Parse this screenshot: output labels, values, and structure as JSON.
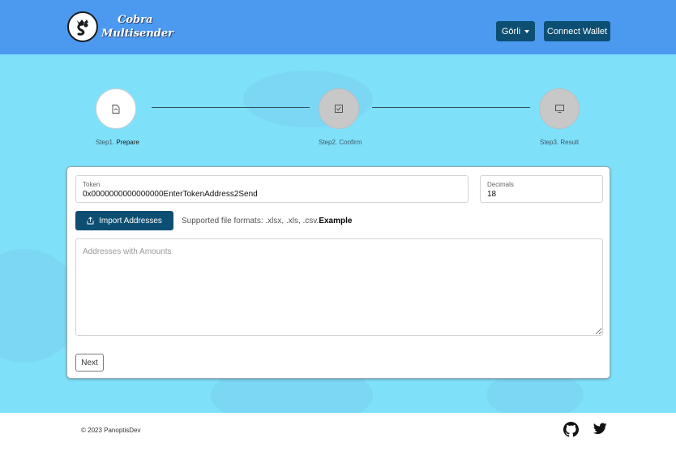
{
  "header": {
    "logo_line1": "Cobra",
    "logo_line2": "Multisender",
    "network_label": "Görli",
    "connect_label": "Connect Wallet"
  },
  "steps": [
    {
      "prefix": "Step1.",
      "name": "Prepare",
      "status": "active",
      "icon": "file-icon"
    },
    {
      "prefix": "Step2.",
      "name": "Confirm",
      "status": "inactive",
      "icon": "check-square-icon"
    },
    {
      "prefix": "Step3.",
      "name": "Result",
      "status": "inactive",
      "icon": "monitor-icon"
    }
  ],
  "form": {
    "token_label": "Token",
    "token_value": "0x0000000000000000EnterTokenAddress2Send",
    "decimals_label": "Decimals",
    "decimals_value": "18",
    "import_label": "Import Addresses",
    "formats_text": "Supported file formats: .xlsx, .xls, .csv.",
    "example_label": "Example",
    "addresses_placeholder": "Addresses with Amounts",
    "next_label": "Next"
  },
  "footer": {
    "copyright": "© 2023 PanoptisDev"
  },
  "colors": {
    "header_bg": "#4b9af0",
    "main_bg": "#7fe0fa",
    "button_bg": "#0d4f73"
  }
}
